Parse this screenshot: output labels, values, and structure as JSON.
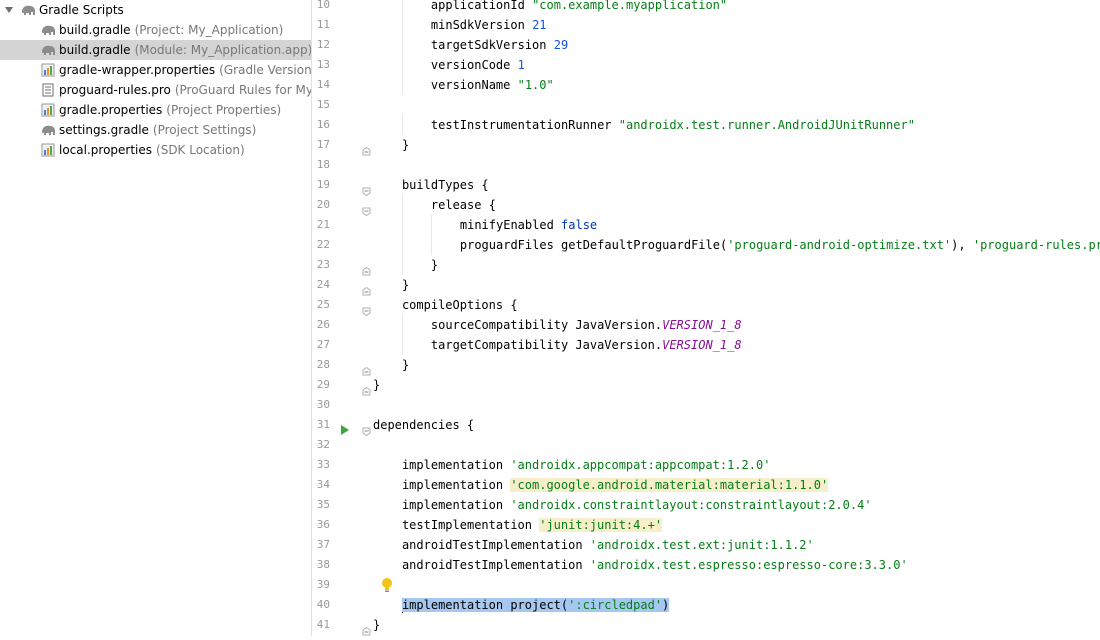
{
  "project_tree": {
    "group_label": "Gradle Scripts",
    "items": [
      {
        "name": "build.gradle",
        "hint": "(Project: My_Application)",
        "icon": "gradle-elephant-icon",
        "selected": false
      },
      {
        "name": "build.gradle",
        "hint": "(Module: My_Application.app)",
        "icon": "gradle-elephant-icon",
        "selected": true
      },
      {
        "name": "gradle-wrapper.properties",
        "hint": "(Gradle Version)",
        "icon": "properties-file-icon",
        "selected": false
      },
      {
        "name": "proguard-rules.pro",
        "hint": "(ProGuard Rules for My_App",
        "icon": "text-file-icon",
        "selected": false
      },
      {
        "name": "gradle.properties",
        "hint": "(Project Properties)",
        "icon": "properties-file-icon",
        "selected": false
      },
      {
        "name": "settings.gradle",
        "hint": "(Project Settings)",
        "icon": "gradle-elephant-icon",
        "selected": false
      },
      {
        "name": "local.properties",
        "hint": "(SDK Location)",
        "icon": "properties-file-icon",
        "selected": false
      }
    ]
  },
  "editor": {
    "lines": [
      {
        "n": "10",
        "indent": 2,
        "segs": [
          [
            "plain",
            "applicationId "
          ],
          [
            "str",
            "\"com.example.myapplication\""
          ]
        ]
      },
      {
        "n": "11",
        "indent": 2,
        "segs": [
          [
            "plain",
            "minSdkVersion "
          ],
          [
            "num",
            "21"
          ]
        ]
      },
      {
        "n": "12",
        "indent": 2,
        "segs": [
          [
            "plain",
            "targetSdkVersion "
          ],
          [
            "num",
            "29"
          ]
        ]
      },
      {
        "n": "13",
        "indent": 2,
        "segs": [
          [
            "plain",
            "versionCode "
          ],
          [
            "num",
            "1"
          ]
        ]
      },
      {
        "n": "14",
        "indent": 2,
        "segs": [
          [
            "plain",
            "versionName "
          ],
          [
            "str",
            "\"1.0\""
          ]
        ]
      },
      {
        "n": "15",
        "indent": 0,
        "segs": []
      },
      {
        "n": "16",
        "indent": 2,
        "segs": [
          [
            "plain",
            "testInstrumentationRunner "
          ],
          [
            "str",
            "\"androidx.test.runner.AndroidJUnitRunner\""
          ]
        ]
      },
      {
        "n": "17",
        "indent": 1,
        "segs": [
          [
            "plain",
            "}"
          ]
        ]
      },
      {
        "n": "18",
        "indent": 0,
        "segs": []
      },
      {
        "n": "19",
        "indent": 1,
        "segs": [
          [
            "plain",
            "buildTypes {"
          ]
        ]
      },
      {
        "n": "20",
        "indent": 2,
        "segs": [
          [
            "plain",
            "release {"
          ]
        ]
      },
      {
        "n": "21",
        "indent": 3,
        "segs": [
          [
            "plain",
            "minifyEnabled "
          ],
          [
            "kw",
            "false"
          ]
        ]
      },
      {
        "n": "22",
        "indent": 3,
        "segs": [
          [
            "plain",
            "proguardFiles getDefaultProguardFile("
          ],
          [
            "str",
            "'proguard-android-optimize.txt'"
          ],
          [
            "plain",
            "), "
          ],
          [
            "str",
            "'proguard-rules.pro'"
          ]
        ]
      },
      {
        "n": "23",
        "indent": 2,
        "segs": [
          [
            "plain",
            "}"
          ]
        ]
      },
      {
        "n": "24",
        "indent": 1,
        "segs": [
          [
            "plain",
            "}"
          ]
        ]
      },
      {
        "n": "25",
        "indent": 1,
        "segs": [
          [
            "plain",
            "compileOptions {"
          ]
        ]
      },
      {
        "n": "26",
        "indent": 2,
        "segs": [
          [
            "plain",
            "sourceCompatibility JavaVersion."
          ],
          [
            "const",
            "VERSION_1_8"
          ]
        ]
      },
      {
        "n": "27",
        "indent": 2,
        "segs": [
          [
            "plain",
            "targetCompatibility JavaVersion."
          ],
          [
            "const",
            "VERSION_1_8"
          ]
        ]
      },
      {
        "n": "28",
        "indent": 1,
        "segs": [
          [
            "plain",
            "}"
          ]
        ]
      },
      {
        "n": "29",
        "indent": 0,
        "segs": [
          [
            "plain",
            "}"
          ]
        ]
      },
      {
        "n": "30",
        "indent": 0,
        "segs": []
      },
      {
        "n": "31",
        "indent": 0,
        "segs": [
          [
            "plain",
            "dependencies {"
          ]
        ]
      },
      {
        "n": "32",
        "indent": 0,
        "segs": []
      },
      {
        "n": "33",
        "indent": 1,
        "segs": [
          [
            "plain",
            "implementation "
          ],
          [
            "str",
            "'androidx.appcompat:appcompat:1.2.0'"
          ]
        ]
      },
      {
        "n": "34",
        "indent": 1,
        "segs": [
          [
            "plain",
            "implementation "
          ],
          [
            "strhl",
            "'com.google.android.material:material:1.1.0'"
          ]
        ]
      },
      {
        "n": "35",
        "indent": 1,
        "segs": [
          [
            "plain",
            "implementation "
          ],
          [
            "str",
            "'androidx.constraintlayout:constraintlayout:2.0.4'"
          ]
        ]
      },
      {
        "n": "36",
        "indent": 1,
        "segs": [
          [
            "plain",
            "testImplementation "
          ],
          [
            "strhl",
            "'junit:junit:4.+'"
          ]
        ]
      },
      {
        "n": "37",
        "indent": 1,
        "segs": [
          [
            "plain",
            "androidTestImplementation "
          ],
          [
            "str",
            "'androidx.test.ext:junit:1.1.2'"
          ]
        ]
      },
      {
        "n": "38",
        "indent": 1,
        "segs": [
          [
            "plain",
            "androidTestImplementation "
          ],
          [
            "str",
            "'androidx.test.espresso:espresso-core:3.3.0'"
          ]
        ]
      },
      {
        "n": "39",
        "indent": 0,
        "segs": []
      },
      {
        "n": "40",
        "indent": 1,
        "segs": [
          [
            "selplain",
            "implementation project("
          ],
          [
            "selstr",
            "':circledpad'"
          ],
          [
            "selplain",
            ")"
          ]
        ],
        "caret": true
      },
      {
        "n": "41",
        "indent": 0,
        "segs": [
          [
            "plain",
            "}"
          ]
        ]
      }
    ]
  },
  "colors": {
    "string": "#067d17",
    "number": "#1750eb",
    "keyword": "#0033b3",
    "constant": "#871094",
    "selection": "#a6c8f0",
    "caret_line": "#fcfaed",
    "highlight_bg": "#f6efc9"
  }
}
